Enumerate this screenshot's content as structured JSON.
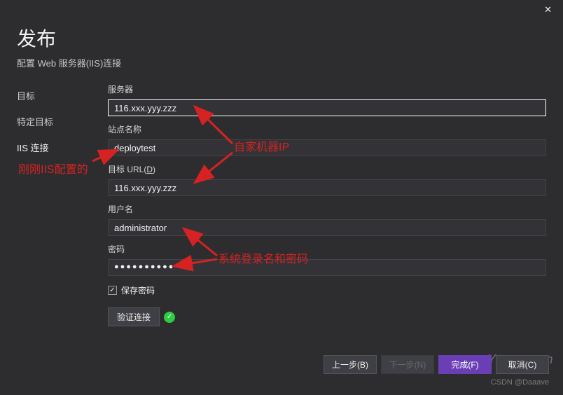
{
  "window": {
    "close": "✕",
    "title": "发布",
    "subtitle": "配置 Web 服务器(IIS)连接"
  },
  "sidebar": {
    "items": [
      {
        "label": "目标"
      },
      {
        "label": "特定目标"
      },
      {
        "label": "IIS 连接"
      }
    ]
  },
  "form": {
    "server_label": "服务器",
    "server_value": "116.xxx.yyy.zzz",
    "site_label": "站点名称",
    "site_value": "deploytest",
    "desturl_label_pre": "目标 URL(",
    "desturl_label_u": "D",
    "desturl_label_post": ")",
    "desturl_value": "116.xxx.yyy.zzz",
    "user_label": "用户名",
    "user_value": "administrator",
    "pw_label": "密码",
    "pw_value": "●●●●●●●●●●",
    "save_pw_label": "保存密码",
    "save_pw_checked": "✓",
    "validate_label": "验证连接",
    "validate_ok": "✓"
  },
  "annotations": {
    "iis_config": "刚刚IIS配置的",
    "own_ip": "自家机器IP",
    "login_pw": "系统登录名和密码"
  },
  "footer": {
    "back": "上一步(B)",
    "next": "下一步(N)",
    "finish": "完成(F)",
    "cancel": "取消(C)",
    "credit": "CSDN @Daaave"
  },
  "watermark": "Yuucn.com"
}
